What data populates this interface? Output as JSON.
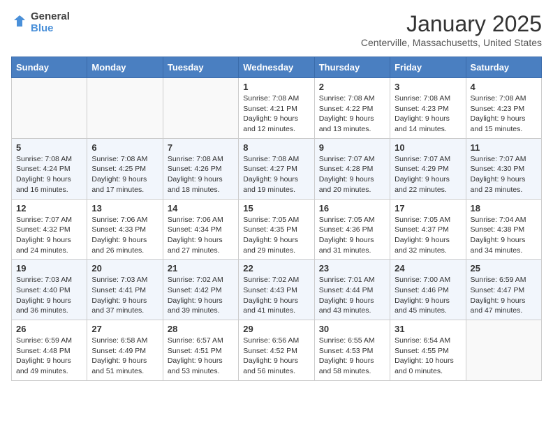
{
  "logo": {
    "general": "General",
    "blue": "Blue"
  },
  "title": "January 2025",
  "location": "Centerville, Massachusetts, United States",
  "headers": [
    "Sunday",
    "Monday",
    "Tuesday",
    "Wednesday",
    "Thursday",
    "Friday",
    "Saturday"
  ],
  "weeks": [
    [
      {
        "day": "",
        "sunrise": "",
        "sunset": "",
        "daylight": ""
      },
      {
        "day": "",
        "sunrise": "",
        "sunset": "",
        "daylight": ""
      },
      {
        "day": "",
        "sunrise": "",
        "sunset": "",
        "daylight": ""
      },
      {
        "day": "1",
        "sunrise": "Sunrise: 7:08 AM",
        "sunset": "Sunset: 4:21 PM",
        "daylight": "Daylight: 9 hours and 12 minutes."
      },
      {
        "day": "2",
        "sunrise": "Sunrise: 7:08 AM",
        "sunset": "Sunset: 4:22 PM",
        "daylight": "Daylight: 9 hours and 13 minutes."
      },
      {
        "day": "3",
        "sunrise": "Sunrise: 7:08 AM",
        "sunset": "Sunset: 4:23 PM",
        "daylight": "Daylight: 9 hours and 14 minutes."
      },
      {
        "day": "4",
        "sunrise": "Sunrise: 7:08 AM",
        "sunset": "Sunset: 4:23 PM",
        "daylight": "Daylight: 9 hours and 15 minutes."
      }
    ],
    [
      {
        "day": "5",
        "sunrise": "Sunrise: 7:08 AM",
        "sunset": "Sunset: 4:24 PM",
        "daylight": "Daylight: 9 hours and 16 minutes."
      },
      {
        "day": "6",
        "sunrise": "Sunrise: 7:08 AM",
        "sunset": "Sunset: 4:25 PM",
        "daylight": "Daylight: 9 hours and 17 minutes."
      },
      {
        "day": "7",
        "sunrise": "Sunrise: 7:08 AM",
        "sunset": "Sunset: 4:26 PM",
        "daylight": "Daylight: 9 hours and 18 minutes."
      },
      {
        "day": "8",
        "sunrise": "Sunrise: 7:08 AM",
        "sunset": "Sunset: 4:27 PM",
        "daylight": "Daylight: 9 hours and 19 minutes."
      },
      {
        "day": "9",
        "sunrise": "Sunrise: 7:07 AM",
        "sunset": "Sunset: 4:28 PM",
        "daylight": "Daylight: 9 hours and 20 minutes."
      },
      {
        "day": "10",
        "sunrise": "Sunrise: 7:07 AM",
        "sunset": "Sunset: 4:29 PM",
        "daylight": "Daylight: 9 hours and 22 minutes."
      },
      {
        "day": "11",
        "sunrise": "Sunrise: 7:07 AM",
        "sunset": "Sunset: 4:30 PM",
        "daylight": "Daylight: 9 hours and 23 minutes."
      }
    ],
    [
      {
        "day": "12",
        "sunrise": "Sunrise: 7:07 AM",
        "sunset": "Sunset: 4:32 PM",
        "daylight": "Daylight: 9 hours and 24 minutes."
      },
      {
        "day": "13",
        "sunrise": "Sunrise: 7:06 AM",
        "sunset": "Sunset: 4:33 PM",
        "daylight": "Daylight: 9 hours and 26 minutes."
      },
      {
        "day": "14",
        "sunrise": "Sunrise: 7:06 AM",
        "sunset": "Sunset: 4:34 PM",
        "daylight": "Daylight: 9 hours and 27 minutes."
      },
      {
        "day": "15",
        "sunrise": "Sunrise: 7:05 AM",
        "sunset": "Sunset: 4:35 PM",
        "daylight": "Daylight: 9 hours and 29 minutes."
      },
      {
        "day": "16",
        "sunrise": "Sunrise: 7:05 AM",
        "sunset": "Sunset: 4:36 PM",
        "daylight": "Daylight: 9 hours and 31 minutes."
      },
      {
        "day": "17",
        "sunrise": "Sunrise: 7:05 AM",
        "sunset": "Sunset: 4:37 PM",
        "daylight": "Daylight: 9 hours and 32 minutes."
      },
      {
        "day": "18",
        "sunrise": "Sunrise: 7:04 AM",
        "sunset": "Sunset: 4:38 PM",
        "daylight": "Daylight: 9 hours and 34 minutes."
      }
    ],
    [
      {
        "day": "19",
        "sunrise": "Sunrise: 7:03 AM",
        "sunset": "Sunset: 4:40 PM",
        "daylight": "Daylight: 9 hours and 36 minutes."
      },
      {
        "day": "20",
        "sunrise": "Sunrise: 7:03 AM",
        "sunset": "Sunset: 4:41 PM",
        "daylight": "Daylight: 9 hours and 37 minutes."
      },
      {
        "day": "21",
        "sunrise": "Sunrise: 7:02 AM",
        "sunset": "Sunset: 4:42 PM",
        "daylight": "Daylight: 9 hours and 39 minutes."
      },
      {
        "day": "22",
        "sunrise": "Sunrise: 7:02 AM",
        "sunset": "Sunset: 4:43 PM",
        "daylight": "Daylight: 9 hours and 41 minutes."
      },
      {
        "day": "23",
        "sunrise": "Sunrise: 7:01 AM",
        "sunset": "Sunset: 4:44 PM",
        "daylight": "Daylight: 9 hours and 43 minutes."
      },
      {
        "day": "24",
        "sunrise": "Sunrise: 7:00 AM",
        "sunset": "Sunset: 4:46 PM",
        "daylight": "Daylight: 9 hours and 45 minutes."
      },
      {
        "day": "25",
        "sunrise": "Sunrise: 6:59 AM",
        "sunset": "Sunset: 4:47 PM",
        "daylight": "Daylight: 9 hours and 47 minutes."
      }
    ],
    [
      {
        "day": "26",
        "sunrise": "Sunrise: 6:59 AM",
        "sunset": "Sunset: 4:48 PM",
        "daylight": "Daylight: 9 hours and 49 minutes."
      },
      {
        "day": "27",
        "sunrise": "Sunrise: 6:58 AM",
        "sunset": "Sunset: 4:49 PM",
        "daylight": "Daylight: 9 hours and 51 minutes."
      },
      {
        "day": "28",
        "sunrise": "Sunrise: 6:57 AM",
        "sunset": "Sunset: 4:51 PM",
        "daylight": "Daylight: 9 hours and 53 minutes."
      },
      {
        "day": "29",
        "sunrise": "Sunrise: 6:56 AM",
        "sunset": "Sunset: 4:52 PM",
        "daylight": "Daylight: 9 hours and 56 minutes."
      },
      {
        "day": "30",
        "sunrise": "Sunrise: 6:55 AM",
        "sunset": "Sunset: 4:53 PM",
        "daylight": "Daylight: 9 hours and 58 minutes."
      },
      {
        "day": "31",
        "sunrise": "Sunrise: 6:54 AM",
        "sunset": "Sunset: 4:55 PM",
        "daylight": "Daylight: 10 hours and 0 minutes."
      },
      {
        "day": "",
        "sunrise": "",
        "sunset": "",
        "daylight": ""
      }
    ]
  ]
}
